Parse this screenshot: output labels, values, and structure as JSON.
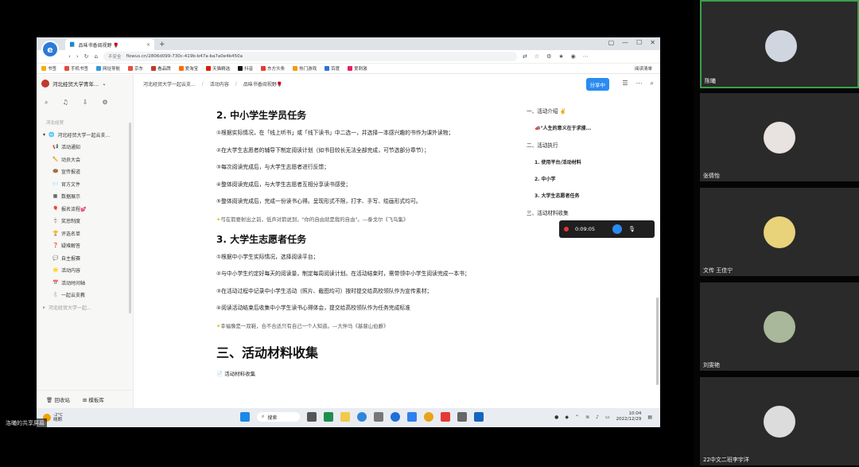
{
  "screen_share": {
    "label": "洛曦的共享屏幕"
  },
  "browser": {
    "tab_title": "品味书香阅视野 🌹",
    "tab_close": "×",
    "new_tab": "+",
    "not_secure": "不安全",
    "url": "flowus.cn/2806d099-730c-419b-b47a-ba7a0e4b450a",
    "bookmarks": [
      "书签",
      "手机书签",
      "网址导航",
      "京东",
      "看品牌",
      "爱淘宝",
      "天猫精选",
      "抖音",
      "东方头条",
      "热门游戏",
      "百度",
      "爱刺激"
    ],
    "bookmarks_right": "阅读清单"
  },
  "sidebar": {
    "workspace": "河北经贸大学青年...",
    "section": "河北经贸",
    "root": "河北经贸大学一起云支...",
    "items": [
      {
        "icon": "📢",
        "label": "活动通知"
      },
      {
        "icon": "✏️",
        "label": "动员大会"
      },
      {
        "icon": "🍩",
        "label": "宣传报道"
      },
      {
        "icon": "📨",
        "label": "官方文件"
      },
      {
        "icon": "▦",
        "label": "数据展示"
      },
      {
        "icon": "🎈",
        "label": "报名流程💕"
      },
      {
        "icon": "🪧",
        "label": "奖惩制度"
      },
      {
        "icon": "🏆",
        "label": "评选名单"
      },
      {
        "icon": "❓",
        "label": "疑难解答"
      },
      {
        "icon": "💬",
        "label": "自主报赛"
      },
      {
        "icon": "🌟",
        "label": "活动内容"
      },
      {
        "icon": "📅",
        "label": "活动时间轴"
      },
      {
        "icon": "🐇",
        "label": "一起云支教"
      }
    ],
    "more": "河北经贸大学一起...",
    "trash": "回收站",
    "templates": "模板库"
  },
  "main": {
    "breadcrumbs": [
      "河北经贸大学一起云支...",
      "活动内容",
      "品味书香阅视野🌹"
    ],
    "share_button": "分享中",
    "section2_title": "2. 中小学生学员任务",
    "section2_items": [
      "①根据实际情况，在「线上听书」或「线下读书」中二选一，并选择一本感兴趣的书作为课外读物；",
      "②在大学生志愿者的辅导下制定阅读计划（如书目较长无法全部完成，可节选部分章节）；",
      "③每次阅读完成后，与大学生志愿者进行反馈；",
      "④整体阅读完成后，与大学生志愿者互相分享读书感受；",
      "⑤整体阅读完成后，完成一份读书心得。呈现形式不限，打字、手写、绘画形式均可。"
    ],
    "quote2": "弓在箭要射出之前，低声对箭说到，\"你的自由就是我的自由\"。—泰戈尔《飞鸟集》",
    "section3_title": "3. 大学生志愿者任务",
    "section3_items": [
      "①根据中小学生实际情况，选择阅读平台；",
      "②与中小学生约定好每天的阅读量，制定每周阅读计划。在活动结束时，需带领中小学生阅读完成一本书；",
      "③在活动过程中记录中小学生活动（照片、截图均可）按时提交给高校领队作为宣传素材；",
      "④阅读活动结束后收集中小学生读书心得体会，提交给高校领队作为任务完成标准"
    ],
    "quote3": "幸福像是一双鞋，合不合适只有自己一个人知道。—大仲马《基督山伯爵》",
    "heading_collect": "三、活动材料收集",
    "file_label": "活动材料收集"
  },
  "toc": {
    "items": [
      "一、活动介绍 ✌️",
      "📣\"人生的意义在于求搜...",
      "二、活动执行",
      "1. 使用平台/活动材料",
      "2. 中小学",
      "3. 大学生志愿者任务",
      "三、活动材料收集"
    ]
  },
  "recorder": {
    "time": "0:09:05"
  },
  "taskbar": {
    "temp": "-2°C",
    "weather": "晴朗",
    "search": "搜索",
    "time": "10:04",
    "date": "2022/12/29"
  },
  "participants": [
    "陈曦",
    "张倩怡",
    "文传 王佳宁",
    "刘雯艳",
    "22中文二班李宇洋"
  ]
}
